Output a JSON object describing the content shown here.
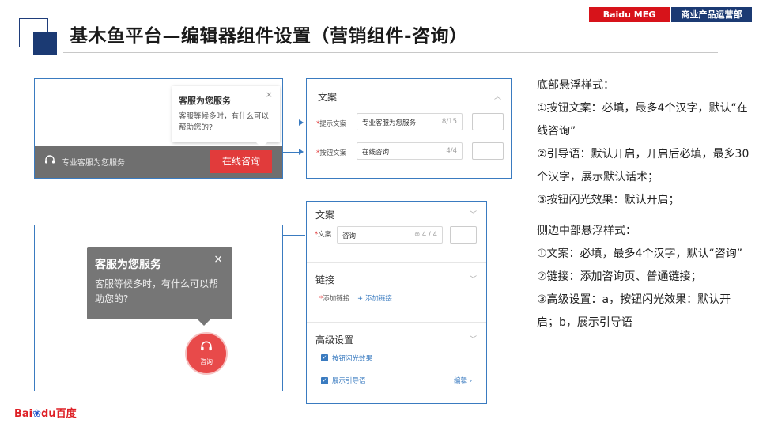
{
  "header": {
    "title": "基木鱼平台—编辑器组件设置（营销组件-咨询）",
    "tag_left": "Baidu MEG",
    "tag_right": "商业产品运营部"
  },
  "bottom_preview": {
    "tooltip_title": "客服为您服务",
    "tooltip_text": "客服等候多时，有什么可以帮助您的?",
    "tooltip_close": "×",
    "bar_text": "专业客服为您服务",
    "button_label": "在线咨询"
  },
  "panel1": {
    "section_title": "文案",
    "row1_label": "提示文案",
    "row1_value": "专业客服为您服务",
    "row1_count": "8/15",
    "row2_label": "按钮文案",
    "row2_value": "在线咨询",
    "row2_count": "4/4"
  },
  "side_preview": {
    "tooltip_title": "客服为您服务",
    "tooltip_text": "客服等候多时，有什么可以帮助您的?",
    "tooltip_close": "×",
    "button_label": "咨询"
  },
  "panel2": {
    "section1_title": "文案",
    "row_label": "文案",
    "row_value": "咨询",
    "row_count": "4 / 4",
    "section2_title": "链接",
    "add_link_label": "添加链接",
    "add_link_button": "+ 添加链接",
    "section3_title": "高级设置",
    "check1_label": "按钮闪光效果",
    "check2_label": "展示引导语",
    "edit_label": "编辑 ›"
  },
  "notes": {
    "bottom_title": "底部悬浮样式：",
    "bottom_line1": "①按钮文案：必填，最多4个汉字，默认“在线咨询”",
    "bottom_line2": "②引导语：默认开启，开启后必填，最多30个汉字，展示默认话术；",
    "bottom_line3": "③按钮闪光效果：默认开启；",
    "side_title": "侧边中部悬浮样式：",
    "side_line1": "①文案：必填，最多4个汉字，默认“咨询”",
    "side_line2": "②链接：添加咨询页、普通链接；",
    "side_line3": "③高级设置：a，按钮闪光效果：默认开启；b，展示引导语"
  },
  "footer": {
    "logo_part1": "Bai",
    "logo_part2": "du",
    "logo_part3": "百度"
  },
  "colors": {
    "accent_blue": "#3a7bc0",
    "brand_red": "#d7131a",
    "brand_navy": "#1b3a73",
    "button_red": "#e13b3b"
  }
}
